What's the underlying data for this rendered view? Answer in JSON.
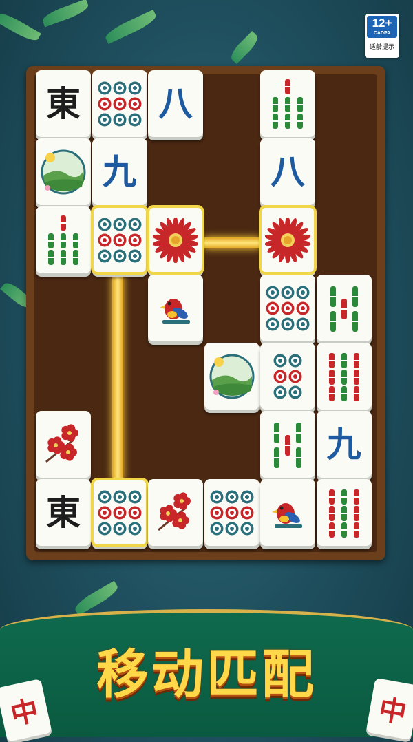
{
  "age_badge": {
    "rating": "12+",
    "org": "CADPA",
    "note": "适龄提示"
  },
  "slogan": "移动匹配",
  "corner_tiles": {
    "left": "中",
    "right": "中"
  },
  "tiles": [
    {
      "id": "r0c0",
      "kind": "char",
      "text": "東",
      "color": "black",
      "selected": false
    },
    {
      "id": "r0c1",
      "kind": "dots",
      "count": 9,
      "selected": false
    },
    {
      "id": "r0c2",
      "kind": "char",
      "text": "八",
      "color": "blue",
      "selected": false
    },
    {
      "id": "r0c4",
      "kind": "bamboo",
      "count": 7,
      "selected": false
    },
    {
      "id": "r1c0",
      "kind": "season",
      "selected": false
    },
    {
      "id": "r1c1",
      "kind": "char",
      "text": "九",
      "color": "blue",
      "selected": false
    },
    {
      "id": "r1c4",
      "kind": "char",
      "text": "八",
      "color": "blue",
      "selected": false
    },
    {
      "id": "r2c0",
      "kind": "bamboo",
      "count": 7,
      "selected": false
    },
    {
      "id": "r2c1",
      "kind": "dots",
      "count": 9,
      "selected": true
    },
    {
      "id": "r2c2",
      "kind": "chrysanthemum",
      "selected": true
    },
    {
      "id": "r2c4",
      "kind": "chrysanthemum",
      "selected": true
    },
    {
      "id": "r3c2",
      "kind": "bird",
      "selected": false
    },
    {
      "id": "r3c4",
      "kind": "dots",
      "count": 9,
      "selected": false
    },
    {
      "id": "r3c5",
      "kind": "bamboo",
      "count": 5,
      "selected": false
    },
    {
      "id": "r4c3",
      "kind": "season",
      "selected": false
    },
    {
      "id": "r4c4",
      "kind": "dots",
      "count": 6,
      "selected": false
    },
    {
      "id": "r4c5",
      "kind": "bamboo",
      "count": 9,
      "selected": false
    },
    {
      "id": "r5c0",
      "kind": "plum",
      "selected": false
    },
    {
      "id": "r5c4",
      "kind": "bamboo",
      "count": 5,
      "selected": false
    },
    {
      "id": "r5c5",
      "kind": "char",
      "text": "九",
      "color": "blue",
      "selected": false
    },
    {
      "id": "r6c0",
      "kind": "char",
      "text": "東",
      "color": "black",
      "selected": false
    },
    {
      "id": "r6c1",
      "kind": "dots",
      "count": 9,
      "selected": true
    },
    {
      "id": "r6c2",
      "kind": "plum",
      "selected": false
    },
    {
      "id": "r6c3",
      "kind": "dots",
      "count": 9,
      "selected": false
    },
    {
      "id": "r6c4",
      "kind": "bird",
      "selected": false
    },
    {
      "id": "r6c5",
      "kind": "bamboo",
      "count": 9,
      "selected": false
    }
  ],
  "colors": {
    "gold": "#f1d64a",
    "wood": "#4a2812",
    "felt": "#0f6a4d"
  }
}
